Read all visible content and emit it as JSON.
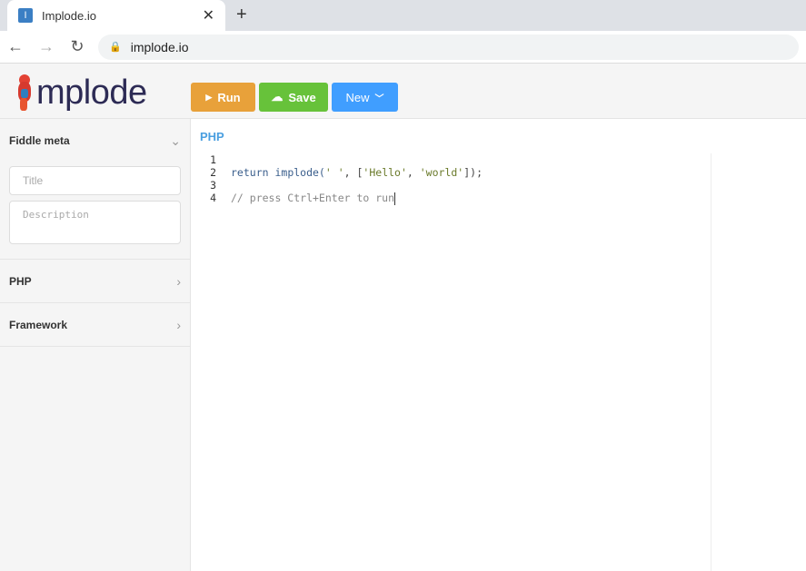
{
  "browser": {
    "tab_title": "Implode.io",
    "favicon_letter": "I",
    "url": "implode.io"
  },
  "header": {
    "logo_text": "mplode",
    "run": "Run",
    "save": "Save",
    "new": "New"
  },
  "sidebar": {
    "meta_title": "Fiddle meta",
    "title_placeholder": "Title",
    "description_placeholder": "Description",
    "php": "PHP",
    "framework": "Framework"
  },
  "editor": {
    "language": "PHP",
    "lines": [
      "1",
      "2",
      "3",
      "4"
    ],
    "code": {
      "kw_return": "return",
      "fn": " implode(",
      "s1": "' '",
      "p1": ", [",
      "s2": "'Hello'",
      "p2": ", ",
      "s3": "'world'",
      "p3": "]);",
      "comment": "// press Ctrl+Enter to run"
    }
  },
  "colors": {
    "run": "#e8a13a",
    "save": "#67c23a",
    "new": "#409eff"
  }
}
